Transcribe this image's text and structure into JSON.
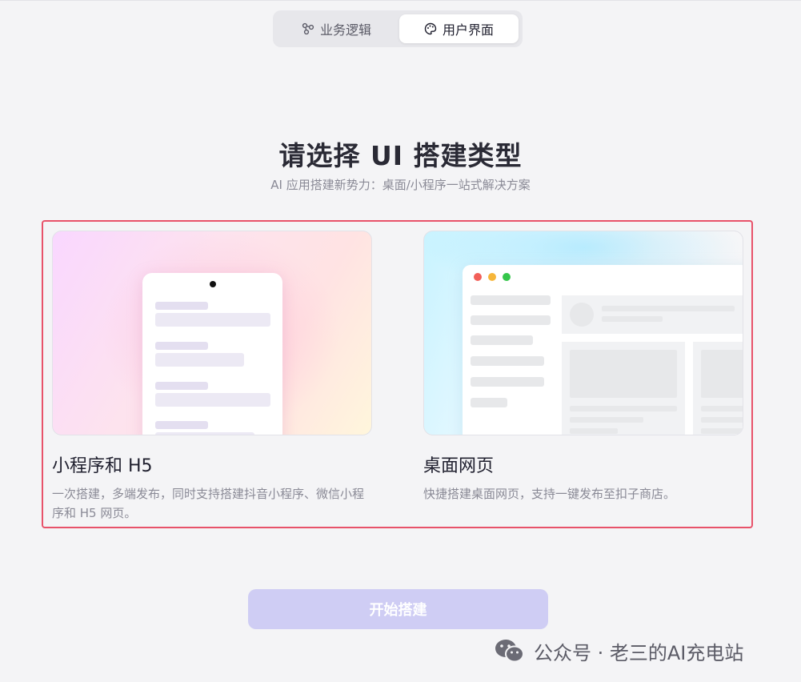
{
  "tabs": [
    {
      "label": "业务逻辑",
      "icon": "nodes-icon",
      "active": false
    },
    {
      "label": "用户界面",
      "icon": "palette-icon",
      "active": true
    }
  ],
  "heading": {
    "title": "请选择 UI 搭建类型",
    "subtitle": "AI 应用搭建新势力：桌面/小程序一站式解决方案"
  },
  "options": [
    {
      "title": "小程序和 H5",
      "desc": "一次搭建，多端发布，同时支持搭建抖音小程序、微信小程序和 H5 网页。"
    },
    {
      "title": "桌面网页",
      "desc": "快捷搭建桌面网页，支持一键发布至扣子商店。"
    }
  ],
  "start_button": "开始搭建",
  "watermark": {
    "text": "公众号 · 老三的AI充电站",
    "icon": "wechat-icon"
  },
  "colors": {
    "highlight": "#e8526a",
    "button": "#cfcdf4"
  }
}
